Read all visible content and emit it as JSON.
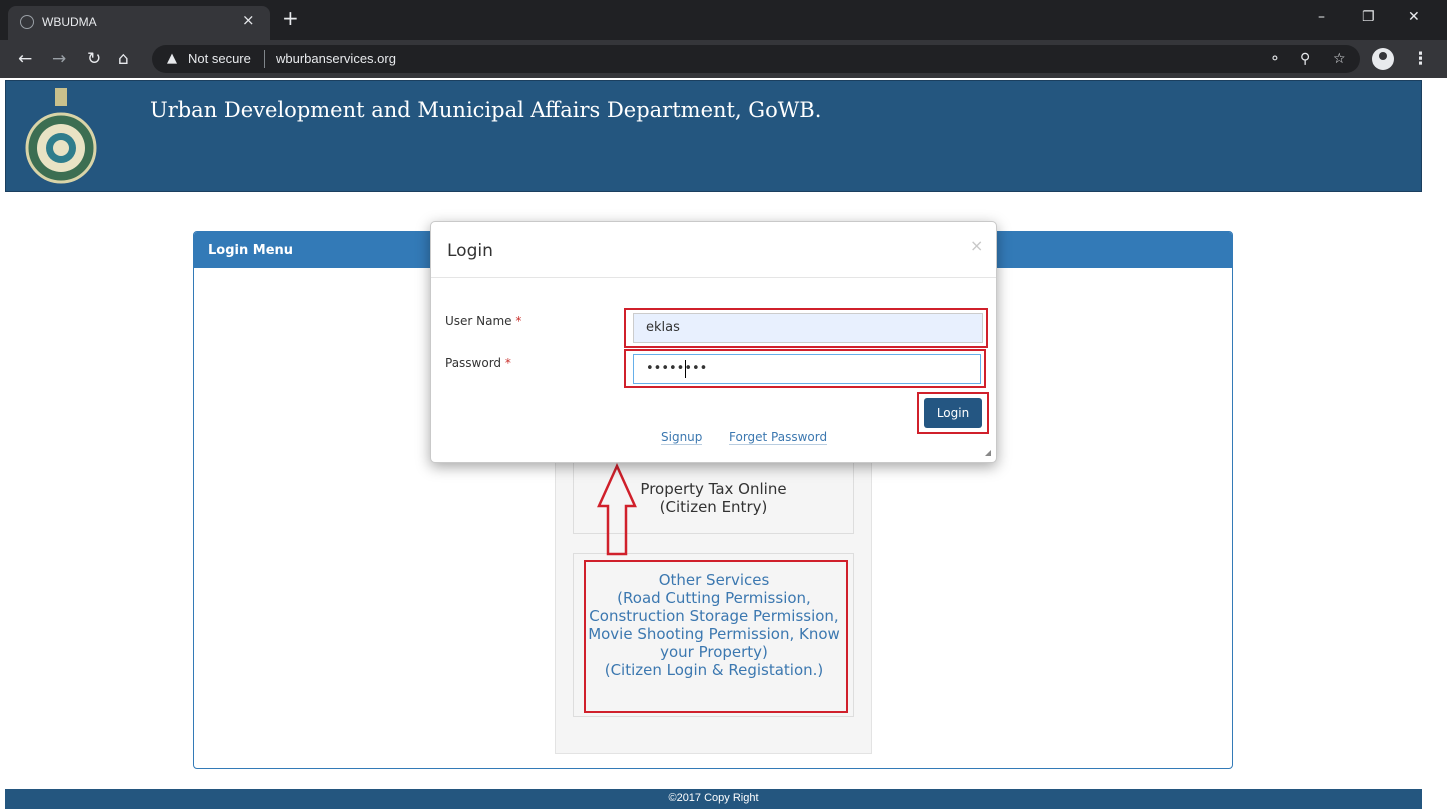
{
  "browser": {
    "tab_title": "WBUDMA",
    "close_tab_glyph": "×",
    "new_tab_glyph": "+",
    "security_label": "Not secure",
    "url": "wburbanservices.org",
    "icons": [
      "back-icon",
      "forward-icon",
      "reload-icon",
      "home-icon",
      "warning-icon",
      "key-icon",
      "zoom-icon",
      "star-icon",
      "profile-icon",
      "menu-icon"
    ]
  },
  "header": {
    "title": "Urban Development and Municipal Affairs Department, GoWB."
  },
  "login_menu": {
    "title": "Login Menu",
    "property_tax": "Property Tax Online\n(Citizen Entry)",
    "other_services": "Other Services\n(Road Cutting Permission, Construction Storage Permission, Movie Shooting Permission, Know your Property)\n(Citizen Login & Registation.)"
  },
  "modal": {
    "title": "Login",
    "close_glyph": "×",
    "username_label": "User Name",
    "password_label": "Password",
    "required_mark": "*",
    "username_value": "eklas",
    "password_value": "••••••••",
    "login_button": "Login",
    "signup_link": "Signup",
    "forget_link": "Forget Password"
  },
  "footer": {
    "text": "©2017 Copy Right"
  },
  "colors": {
    "header_bg": "#24567f",
    "panel_accent": "#337ab7",
    "annotation_red": "#d0202b",
    "link": "#3c78b0"
  }
}
